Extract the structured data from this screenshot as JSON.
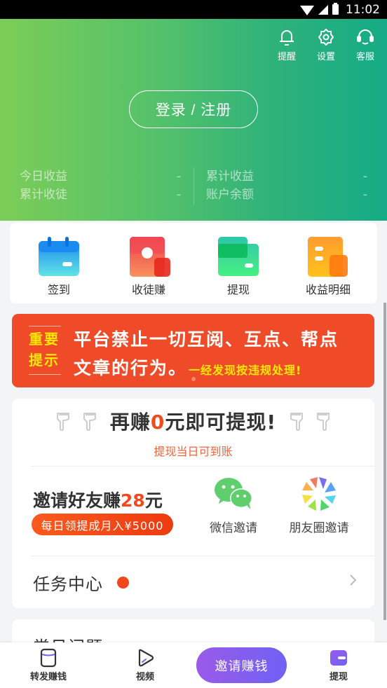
{
  "status_bar": {
    "time": "11:02",
    "icons": [
      "wifi-icon",
      "signal-icon",
      "battery-charging-icon"
    ]
  },
  "header": {
    "actions": [
      {
        "label": "提醒",
        "icon": "bell-icon"
      },
      {
        "label": "设置",
        "icon": "gear-icon"
      },
      {
        "label": "客服",
        "icon": "headset-icon"
      }
    ],
    "login_label": "登录 / 注册",
    "stats": [
      {
        "label": "今日收益",
        "value": "-"
      },
      {
        "label": "累计收徒",
        "value": "-"
      },
      {
        "label": "累计收益",
        "value": "-"
      },
      {
        "label": "账户余额",
        "value": "-"
      }
    ],
    "gradient": [
      "#7ccd57",
      "#15ab86"
    ]
  },
  "quick_entries": [
    {
      "label": "签到",
      "icon": "calendar-icon"
    },
    {
      "label": "收徒赚",
      "icon": "red-envelope-icon"
    },
    {
      "label": "提现",
      "icon": "wallet-icon"
    },
    {
      "label": "收益明细",
      "icon": "ledger-icon"
    }
  ],
  "banner": {
    "tag_line1": "重要",
    "tag_line2": "提示",
    "line1": "平台禁止一切互阅、互点、帮点",
    "line2": "文章的行为。",
    "warning": "一经发现按违规处理!",
    "color": "#ef4b28"
  },
  "withdraw": {
    "title_prefix": "再赚",
    "amount": "0",
    "title_suffix": "元即可提现!",
    "subtitle": "提现当日可到账"
  },
  "invite": {
    "title_prefix": "邀请好友赚",
    "amount": "28",
    "title_suffix": "元",
    "badge": "每日领提成月入¥5000",
    "share_options": [
      {
        "label": "微信邀请",
        "icon": "wechat-icon"
      },
      {
        "label": "朋友圈邀请",
        "icon": "moments-icon"
      }
    ]
  },
  "task_center": {
    "label": "任务中心",
    "has_notification": true
  },
  "faq": {
    "label": "常见问题"
  },
  "bottom_nav": {
    "items": [
      {
        "label": "转发赚钱",
        "icon": "share-article-icon"
      },
      {
        "label": "视频",
        "icon": "play-icon"
      },
      {
        "label": "提现",
        "icon": "wallet-icon",
        "active": true
      }
    ],
    "center_button": "邀请赚钱",
    "accent": "#7a5ff0"
  }
}
